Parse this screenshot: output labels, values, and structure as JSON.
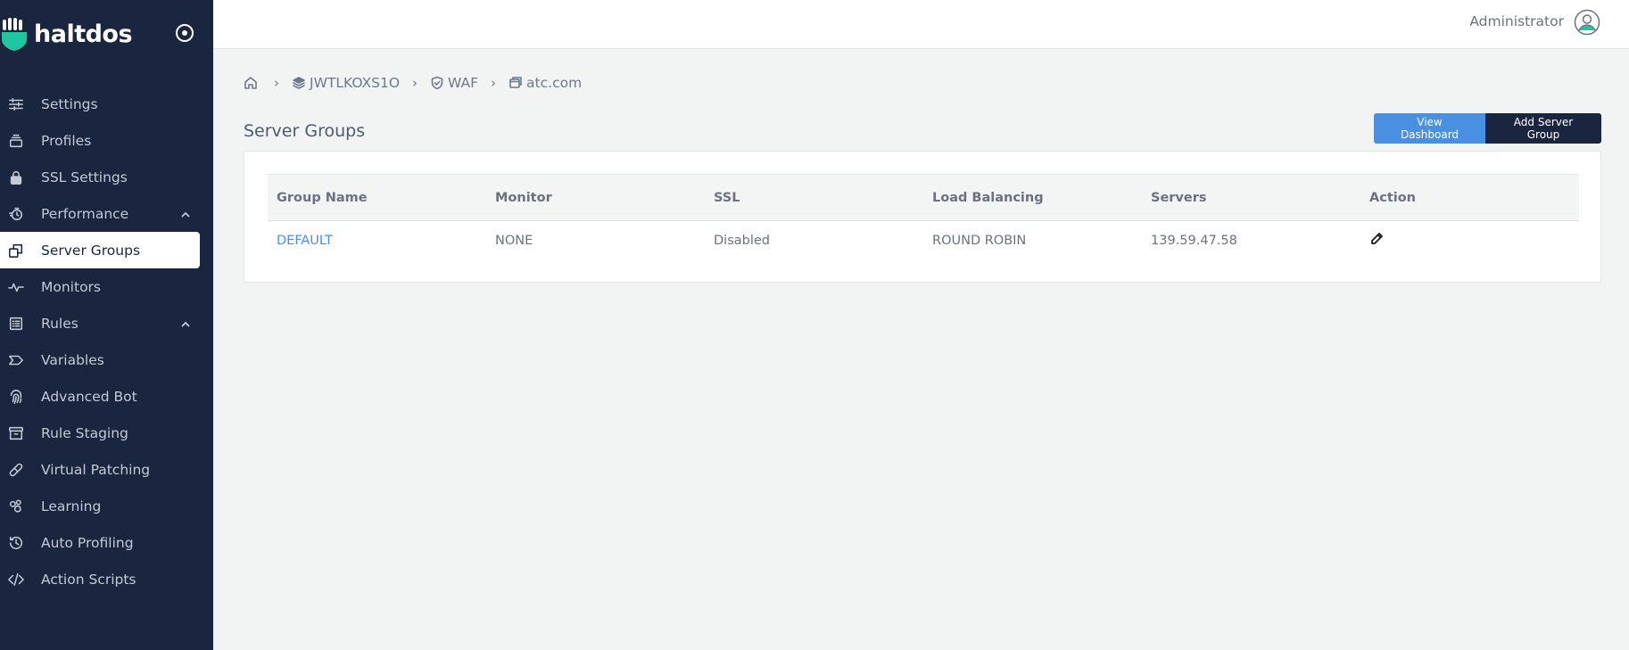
{
  "brand": {
    "name": "haltdos"
  },
  "header": {
    "user_name": "Administrator"
  },
  "sidebar": {
    "items": [
      {
        "label": "Settings",
        "icon": "sliders-icon"
      },
      {
        "label": "Profiles",
        "icon": "stack-icon"
      },
      {
        "label": "SSL Settings",
        "icon": "lock-icon"
      },
      {
        "label": "Performance",
        "icon": "stopwatch-icon",
        "expandable": true
      },
      {
        "label": "Server Groups",
        "icon": "server-groups-icon",
        "active": true
      },
      {
        "label": "Monitors",
        "icon": "pulse-icon"
      },
      {
        "label": "Rules",
        "icon": "list-icon",
        "expandable": true
      },
      {
        "label": "Variables",
        "icon": "tag-icon"
      },
      {
        "label": "Advanced Bot",
        "icon": "fingerprint-icon"
      },
      {
        "label": "Rule Staging",
        "icon": "archive-icon"
      },
      {
        "label": "Virtual Patching",
        "icon": "bandage-icon"
      },
      {
        "label": "Learning",
        "icon": "learning-icon"
      },
      {
        "label": "Auto Profiling",
        "icon": "history-icon"
      },
      {
        "label": "Action Scripts",
        "icon": "code-icon"
      }
    ]
  },
  "breadcrumb": {
    "items": [
      {
        "label": "",
        "icon": "home-icon"
      },
      {
        "label": "JWTLKOXS1O",
        "icon": "layers-icon"
      },
      {
        "label": "WAF",
        "icon": "shield-icon"
      },
      {
        "label": "atc.com",
        "icon": "window-icon"
      }
    ]
  },
  "page": {
    "title": "Server Groups",
    "view_dashboard_label": "View Dashboard",
    "add_server_group_label": "Add Server Group"
  },
  "table": {
    "columns": [
      "Group Name",
      "Monitor",
      "SSL",
      "Load Balancing",
      "Servers",
      "Action"
    ],
    "rows": [
      {
        "group_name": "DEFAULT",
        "monitor": "NONE",
        "ssl": "Disabled",
        "load_balancing": "ROUND ROBIN",
        "servers": "139.59.47.58",
        "action": "edit-icon"
      }
    ]
  },
  "colors": {
    "sidebar_bg": "#1a2540",
    "accent": "#4a90e2",
    "brand_mark": "#1fc7a0"
  }
}
